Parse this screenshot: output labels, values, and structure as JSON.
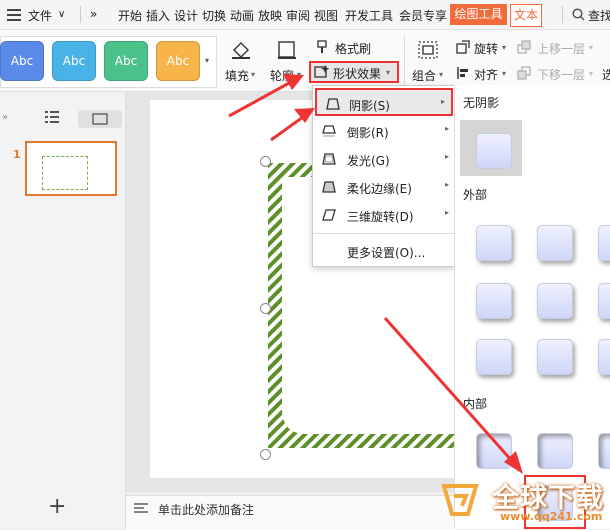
{
  "menubar": {
    "file": "文件",
    "tabs": [
      "开始",
      "插入",
      "设计",
      "切换",
      "动画",
      "放映",
      "审阅",
      "视图",
      "开发工具",
      "会员专享"
    ],
    "active_tab": "绘图工具",
    "text_tab": "文本",
    "search": "查找"
  },
  "toolbar": {
    "swatch_label": "Abc",
    "swatch_colors": [
      "#5b8be8",
      "#49b3e8",
      "#4cc28a",
      "#f6b44a"
    ],
    "fill": "填充",
    "outline": "轮廓",
    "format_painter": "格式刷",
    "shape_effect": "形状效果",
    "group": "组合",
    "rotate": "旋转",
    "align": "对齐",
    "bring_forward": "上移一层",
    "send_backward": "下移一层",
    "extra": "选"
  },
  "effect_menu": {
    "items": [
      {
        "label": "阴影(S)",
        "icon": "shadow-icon"
      },
      {
        "label": "倒影(R)",
        "icon": "reflection-icon"
      },
      {
        "label": "发光(G)",
        "icon": "glow-icon"
      },
      {
        "label": "柔化边缘(E)",
        "icon": "soft-edge-icon"
      },
      {
        "label": "三维旋转(D)",
        "icon": "3d-rotate-icon"
      }
    ],
    "more": "更多设置(O)..."
  },
  "gallery": {
    "no_shadow": "无阴影",
    "outer": "外部",
    "inner": "内部"
  },
  "left_panel": {
    "slide_number": "1",
    "add": "+"
  },
  "notes": {
    "placeholder": "单击此处添加备注"
  },
  "watermark": {
    "title": "全球下载",
    "url": "www.qq241.com"
  },
  "colors": {
    "accent_red": "#e33333",
    "active_tab": "#f26b3a",
    "hatch_green": "#5f8f2a"
  }
}
